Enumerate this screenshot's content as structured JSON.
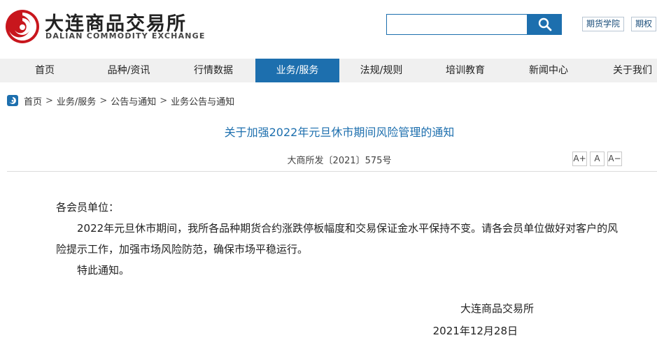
{
  "header": {
    "logo_cn": "大连商品交易所",
    "logo_en": "DALIAN COMMODITY EXCHANGE",
    "search": {
      "placeholder": "",
      "value": ""
    },
    "links": [
      "期货学院",
      "期权"
    ]
  },
  "nav": {
    "items": [
      {
        "label": "首页"
      },
      {
        "label": "品种/资讯"
      },
      {
        "label": "行情数据"
      },
      {
        "label": "业务/服务"
      },
      {
        "label": "法规/规则"
      },
      {
        "label": "培训教育"
      },
      {
        "label": "新闻中心"
      },
      {
        "label": "关于我们"
      }
    ],
    "active_index": 3
  },
  "breadcrumb": {
    "items": [
      "首页",
      "业务/服务",
      "公告与通知",
      "业务公告与通知"
    ],
    "separator": ">"
  },
  "article": {
    "title": "关于加强2022年元旦休市期间风险管理的通知",
    "doc_number": "大商所发〔2021〕575号",
    "font_buttons": [
      "A+",
      "A",
      "A−"
    ],
    "salutation": "各会员单位：",
    "paragraphs": [
      "2022年元旦休市期间，我所各品种期货合约涨跌停板幅度和交易保证金水平保持不变。请各会员单位做好对客户的风险提示工作，加强市场风险防范，确保市场平稳运行。",
      "特此通知。"
    ],
    "signature_org": "大连商品交易所",
    "signature_date": "2021年12月28日"
  },
  "colors": {
    "brand_blue": "#1d6fae",
    "logo_red": "#c8161d",
    "nav_bg": "#f0f0f0"
  }
}
